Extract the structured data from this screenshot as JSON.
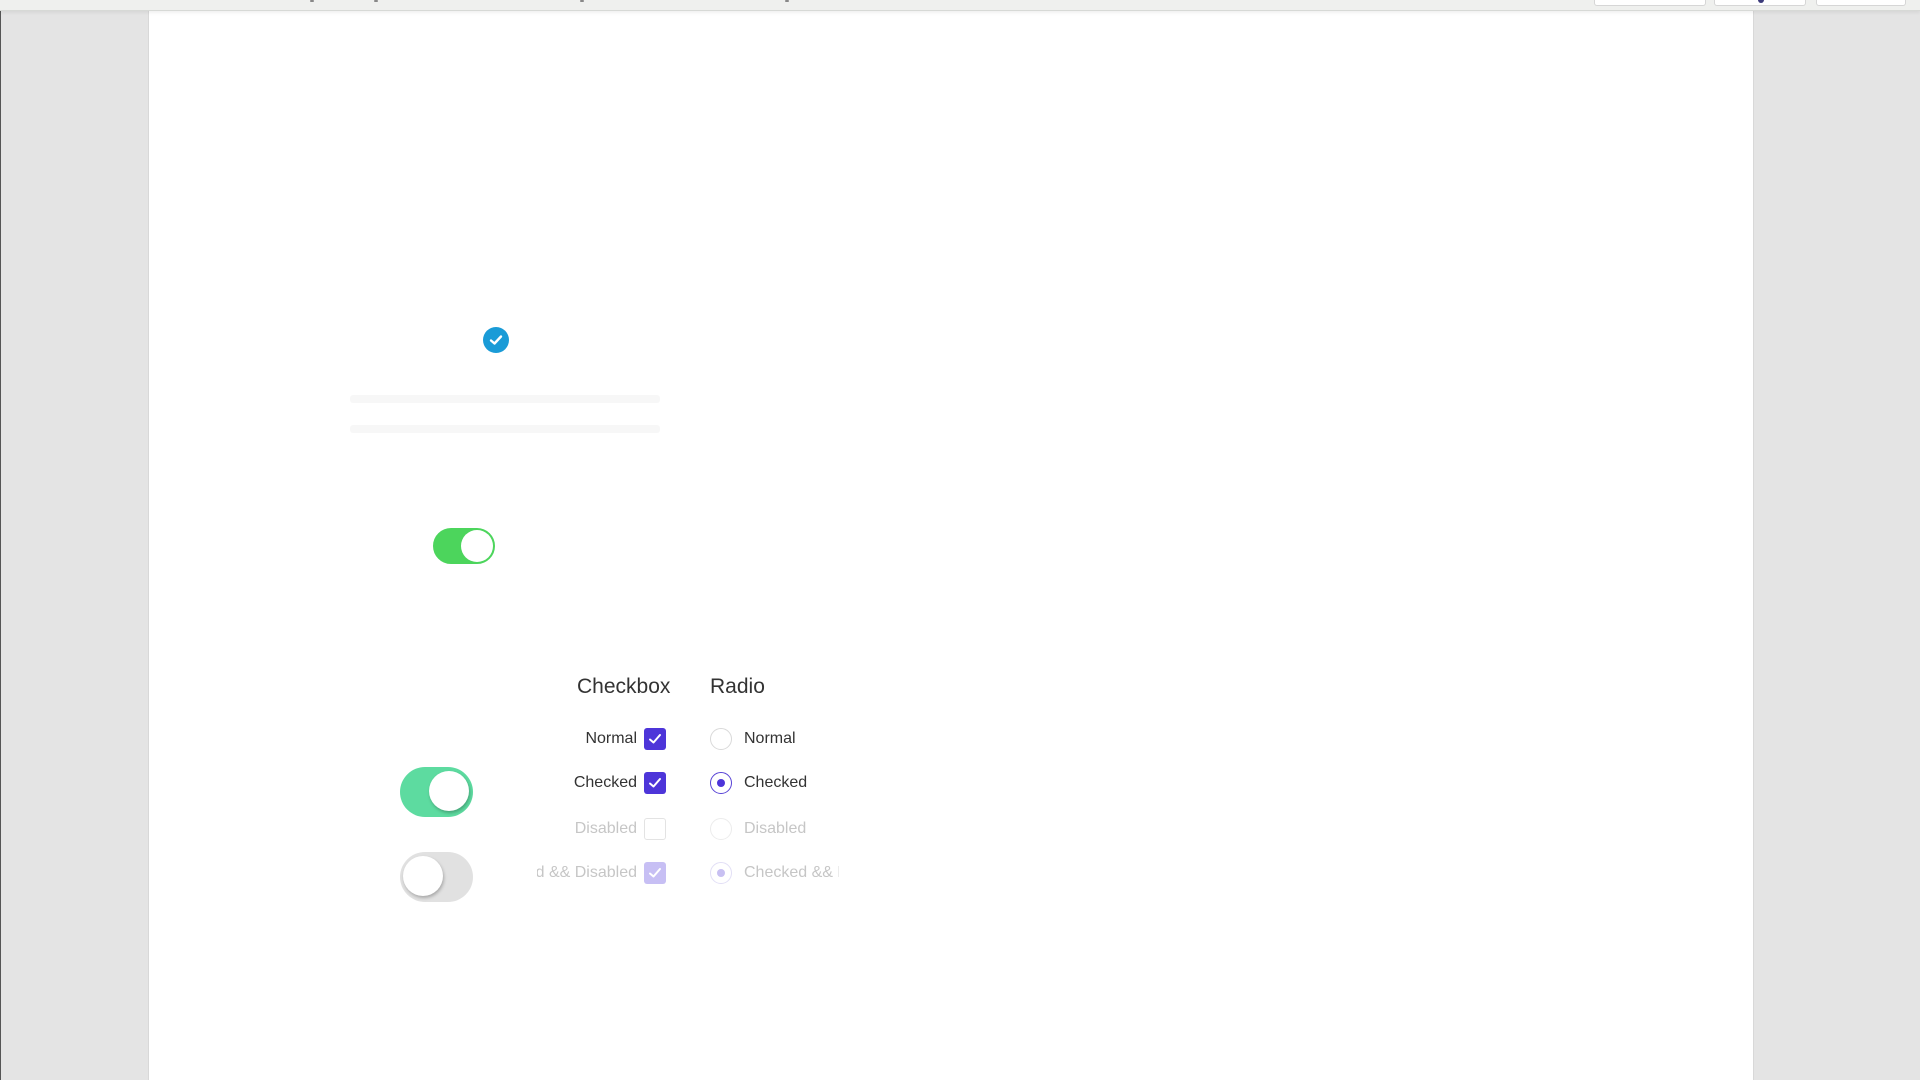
{
  "colors": {
    "primary": "#4d35d9",
    "primary_disabled": "#c7bff4",
    "info_blue": "#1a9bd7",
    "toggle_green": "#4cd55c",
    "toggle_mint": "#5ddba0",
    "toggle_off": "#e1e1e1"
  },
  "icons": {
    "verified": "check-circle-icon",
    "check": "checkmark-icon"
  },
  "toggles": [
    {
      "name": "small-toggle",
      "checked": true
    },
    {
      "name": "large-toggle-on",
      "checked": true
    },
    {
      "name": "large-toggle-off",
      "checked": false
    }
  ],
  "checkbox_section": {
    "title": "Checkbox",
    "rows": [
      {
        "label": "Normal",
        "state": "checked"
      },
      {
        "label": "Checked",
        "state": "checked"
      },
      {
        "label": "Disabled",
        "state": "disabled"
      },
      {
        "label": "Checked && Disabled",
        "state": "checked-disabled"
      }
    ]
  },
  "radio_section": {
    "title": "Radio",
    "rows": [
      {
        "label": "Normal",
        "state": "unchecked"
      },
      {
        "label": "Checked",
        "state": "checked"
      },
      {
        "label": "Disabled",
        "state": "disabled"
      },
      {
        "label": "Checked && Disabled",
        "state": "checked-disabled"
      }
    ]
  }
}
